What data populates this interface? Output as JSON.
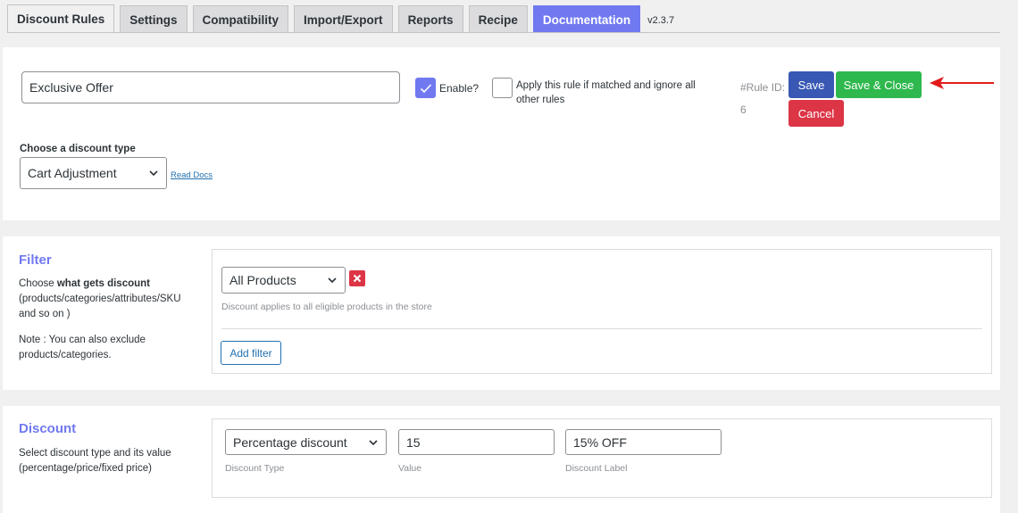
{
  "tabs": [
    {
      "label": "Discount Rules"
    },
    {
      "label": "Settings"
    },
    {
      "label": "Compatibility"
    },
    {
      "label": "Import/Export"
    },
    {
      "label": "Reports"
    },
    {
      "label": "Recipe"
    },
    {
      "label": "Documentation"
    }
  ],
  "version": "v2.3.7",
  "rule": {
    "name": "Exclusive Offer",
    "enable_label": "Enable?",
    "enable_checked": true,
    "apply_label": "Apply this rule if matched and ignore all other rules",
    "apply_checked": false,
    "rule_id_label": "#Rule ID:",
    "rule_id": "6",
    "save_label": "Save",
    "save_close_label": "Save & Close",
    "cancel_label": "Cancel",
    "discount_type_label": "Choose a discount type",
    "discount_type_value": "Cart Adjustment",
    "read_docs": "Read Docs"
  },
  "filter": {
    "title": "Filter",
    "desc_prefix": "Choose ",
    "desc_bold": "what gets discount",
    "desc_rest": " (products/categories/attributes/SKU and so on )",
    "note": "Note : You can also exclude products/categories.",
    "select_value": "All Products",
    "hint": "Discount applies to all eligible products in the store",
    "add_filter": "Add filter"
  },
  "discount": {
    "title": "Discount",
    "desc": "Select discount type and its value (percentage/price/fixed price)",
    "type_value": "Percentage discount",
    "type_hint": "Discount Type",
    "value": "15",
    "value_hint": "Value",
    "label_value": "15% OFF",
    "label_hint": "Discount Label"
  },
  "colors": {
    "accent": "#7079f0",
    "save": "#3858b4",
    "save_close": "#2eb84d",
    "cancel": "#dc3545",
    "arrow": "#e31b1b"
  }
}
